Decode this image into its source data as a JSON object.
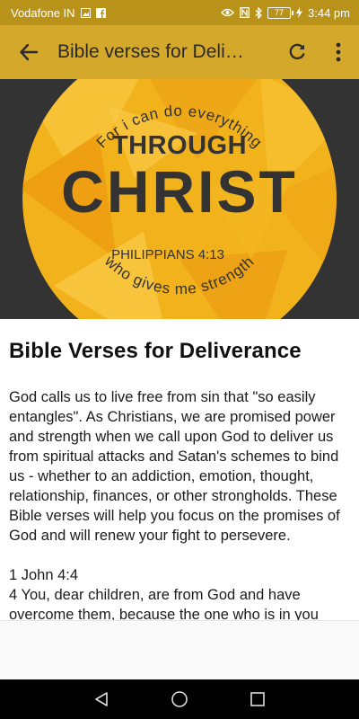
{
  "status_bar": {
    "carrier": "Vodafone IN",
    "battery": "77",
    "time": "3:44 pm"
  },
  "app_bar": {
    "title": "Bible verses for Deli…",
    "back_icon": "arrow-back-icon",
    "refresh_icon": "refresh-icon",
    "menu_icon": "more-vert-icon"
  },
  "hero": {
    "top_arc": "For i can do everything",
    "through": "THROUGH",
    "christ": "CHRIST",
    "reference": "PHILIPPIANS 4:13",
    "bottom_arc": "who gives me strength"
  },
  "article": {
    "heading": "Bible Verses for Deliverance",
    "intro": "God calls us to live free from sin that \"so easily entangles\". As Christians, we are promised power and strength when we call upon God to deliver us from spiritual attacks and Satan's schemes to bind us - whether to an addiction, emotion, thought, relationship, finances, or other strongholds. These Bible verses will help you focus on the promises of God and will renew your fight to persevere.",
    "verse_ref": "1 John 4:4",
    "verse_text": "4 You, dear children, are from God and have overcome them, because the one who is in you"
  },
  "colors": {
    "status_bar": "#b9921a",
    "app_bar": "#d4a82a",
    "hero_bg": "#333333",
    "circle": "#f2b21c"
  }
}
